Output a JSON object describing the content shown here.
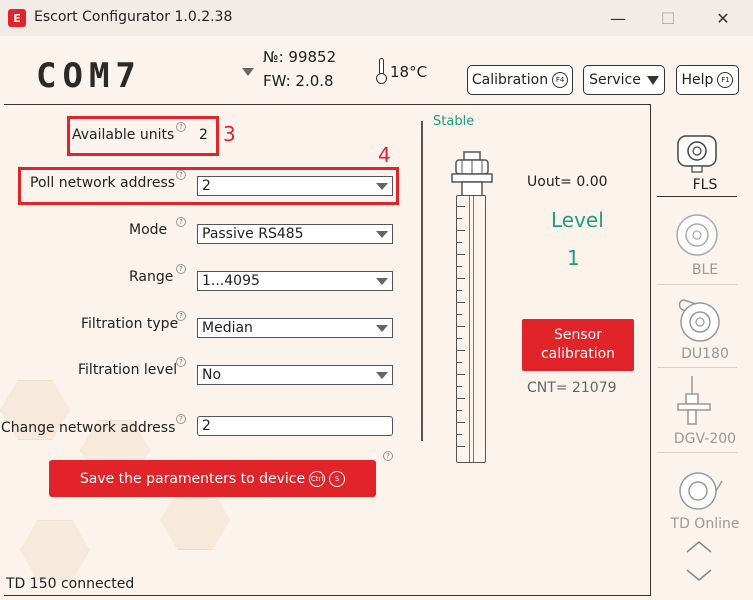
{
  "window": {
    "logo": "E",
    "title": "Escort Configurator 1.0.2.38",
    "minimize": "—",
    "maximize": "☐",
    "close": "✕"
  },
  "header": {
    "port": "COM7",
    "serial": "№:  99852",
    "fw": "FW: 2.0.8",
    "temperature": "18°C",
    "calibration_label": "Calibration",
    "calibration_key": "F4",
    "service_label": "Service",
    "help_label": "Help",
    "help_key": "F1"
  },
  "form": {
    "available_units_label": "Available units",
    "available_units_value": "2",
    "poll_address_label": "Poll network address",
    "poll_address_value": "2",
    "mode_label": "Mode",
    "mode_value": "Passive RS485",
    "range_label": "Range",
    "range_value": "1...4095",
    "filtration_type_label": "Filtration type",
    "filtration_type_value": "Median",
    "filtration_level_label": "Filtration level",
    "filtration_level_value": "No",
    "change_address_label": "Change network address",
    "change_address_value": "2",
    "help_glyph": "?"
  },
  "annotations": {
    "box3": "3",
    "box4": "4"
  },
  "save_button": {
    "label": "Save the paramenters to device",
    "key1": "Ctrl",
    "key2": "S"
  },
  "sensor": {
    "state": "Stable",
    "uout": "Uout=    0.00",
    "level_label": "Level",
    "level_value": "1",
    "calibration_line1": "Sensor",
    "calibration_line2": "calibration",
    "cnt": "CNT= 21079"
  },
  "sidebar": {
    "items": [
      {
        "label": "FLS",
        "icon": "fls-sensor-icon",
        "active": true
      },
      {
        "label": "BLE",
        "icon": "ble-sensor-icon",
        "active": false
      },
      {
        "label": "DU180",
        "icon": "du180-sensor-icon",
        "active": false
      },
      {
        "label": "DGV-200",
        "icon": "dgv200-sensor-icon",
        "active": false
      },
      {
        "label": "TD Online",
        "icon": "td-online-sensor-icon",
        "active": false
      }
    ]
  },
  "status_bar": {
    "text": "TD 150 connected"
  },
  "colors": {
    "accent": "#e0242a",
    "teal": "#1f9e7a",
    "background": "#fbf3ec"
  }
}
